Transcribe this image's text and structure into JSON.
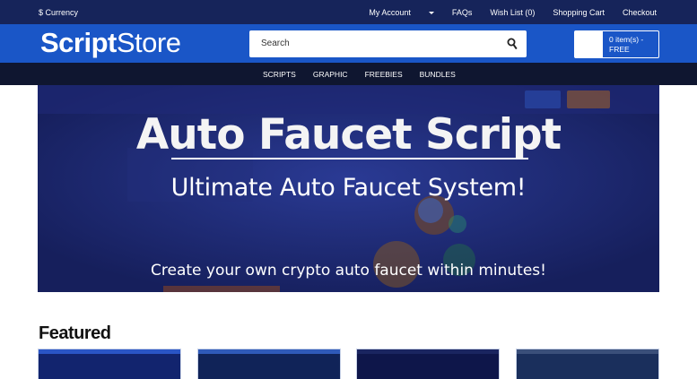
{
  "topbar": {
    "currency": "$ Currency",
    "my_account": "My Account",
    "faqs": "FAQs",
    "wishlist": "Wish List (0)",
    "shopping_cart": "Shopping Cart",
    "checkout": "Checkout"
  },
  "header": {
    "logo_bold": "Script",
    "logo_light": "Store",
    "search_placeholder": "Search",
    "cart_line1": "0 item(s) -",
    "cart_line2": "FREE"
  },
  "nav": {
    "items": [
      "SCRIPTS",
      "GRAPHIC",
      "FREEBIES",
      "BUNDLES"
    ]
  },
  "hero": {
    "title": "Auto Faucet Script",
    "subtitle": "Ultimate Auto Faucet System!",
    "tagline": "Create your own crypto auto faucet within minutes!"
  },
  "featured": {
    "heading": "Featured",
    "item_count": 4
  },
  "colors": {
    "topbar": "#16245a",
    "header": "#1a56c7",
    "nav": "#0f1630",
    "hero_bg": "#1b256e"
  }
}
